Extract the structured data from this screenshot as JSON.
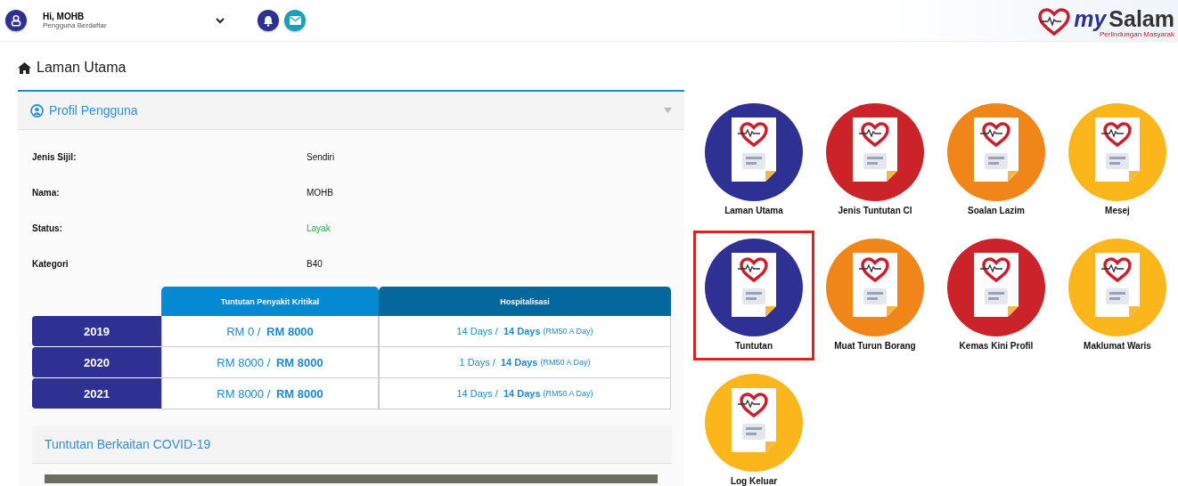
{
  "header": {
    "greeting": "Hi, MOHB",
    "role": "Pengguna Berdaftar",
    "logo": {
      "my": "my",
      "brand": "Salam",
      "tagline": "Perlindungan Masyarak"
    }
  },
  "page_title": "Laman Utama",
  "profile": {
    "title": "Profil Pengguna",
    "expanded": true,
    "fields": [
      {
        "label": "Jenis Sijil:",
        "value": "Sendiri",
        "kind": "plain"
      },
      {
        "label": "Nama:",
        "value": "MOHB",
        "kind": "plain"
      },
      {
        "label": "Status:",
        "value": "Layak",
        "kind": "status"
      },
      {
        "label": "Kategori",
        "value": "B40",
        "kind": "plain"
      }
    ]
  },
  "claims_table": {
    "columns": [
      "Tuntutan Penyakit Kritikal",
      "Hospitalisasi"
    ],
    "rows": [
      {
        "year": "2019",
        "critical": "RM 0 / **RM 8000**",
        "hospital": "14 Days / **14 Days**",
        "note": "(RM50 A Day)"
      },
      {
        "year": "2020",
        "critical": "RM 8000 / **RM 8000**",
        "hospital": "1 Days / **14 Days**",
        "note": "(RM50 A Day)"
      },
      {
        "year": "2021",
        "critical": "RM 8000 / **RM 8000**",
        "hospital": "14 Days / **14 Days**",
        "note": "(RM50 A Day)"
      }
    ]
  },
  "covid_section": {
    "title": "Tuntutan Berkaitan COVID-19"
  },
  "tiles": [
    {
      "label": "Laman Utama",
      "color": "#2e3192",
      "selected": false
    },
    {
      "label": "Jenis Tuntutan CI",
      "color": "#cc2229",
      "selected": false
    },
    {
      "label": "Soalan Lazim",
      "color": "#f0861a",
      "selected": false
    },
    {
      "label": "Mesej",
      "color": "#fbb61b",
      "selected": false
    },
    {
      "label": "Tuntutan",
      "color": "#2e3192",
      "selected": true
    },
    {
      "label": "Muat Turun Borang",
      "color": "#f0861a",
      "selected": false
    },
    {
      "label": "Kemas Kini Profil",
      "color": "#cc2229",
      "selected": false
    },
    {
      "label": "Maklumat Waris",
      "color": "#fbb61b",
      "selected": false
    },
    {
      "label": "Log Keluar",
      "color": "#fbb61b",
      "selected": false
    }
  ]
}
